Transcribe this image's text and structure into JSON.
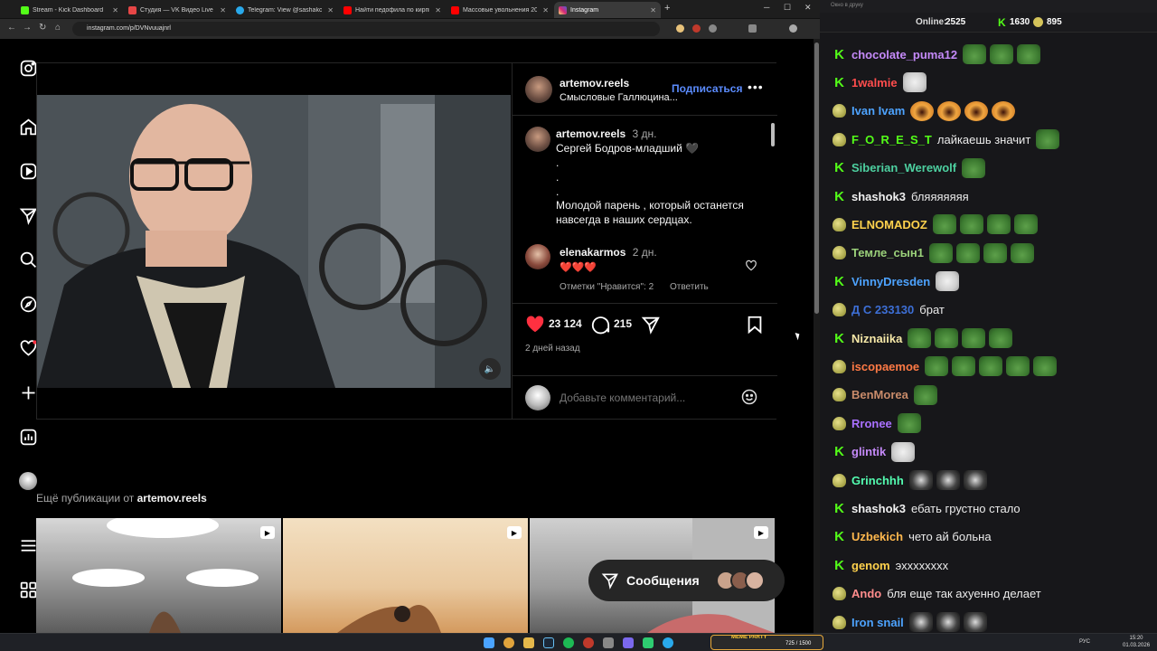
{
  "browser": {
    "tabs": [
      {
        "label": "Stream - Kick Dashboard",
        "color": "#53fc18"
      },
      {
        "label": "Студия — VK Видео Live",
        "color": "#e64646"
      },
      {
        "label": "Telegram: View @sashakon",
        "color": "#29a9eb"
      },
      {
        "label": "Найти педофила по кирпичу",
        "color": "#ff0000"
      },
      {
        "label": "Массовые увольнения 2026. I",
        "color": "#ff0000"
      },
      {
        "label": "Instagram",
        "color": "#d6249f"
      }
    ],
    "url": "instagram.com/p/DVNvuuajnrl"
  },
  "post": {
    "author": "artemov.reels",
    "subtitle": "Смысловые Галлюцина...",
    "follow_label": "Подписаться",
    "caption_author": "artemov.reels",
    "caption_time": "3 дн.",
    "caption_line1": "Сергей Бодров-младший 🖤",
    "caption_dot": ".",
    "caption_text": "Молодой парень , который останется навсегда в наших сердцах.",
    "comment_author": "elenakarmos",
    "comment_time": "2 дн.",
    "comment_text": "❤️❤️❤️",
    "comment_likes": "Отметки \"Нравится\": 2",
    "comment_reply": "Ответить",
    "likes": "23 124",
    "comments_count": "215",
    "posted": "2 дней назад",
    "add_comment_placeholder": "Добавьте комментарий..."
  },
  "more": {
    "prefix": "Ещё публикации от ",
    "author": "artemov.reels"
  },
  "messages_button": "Сообщения",
  "chat": {
    "title": "Окно в друку",
    "online_label": "Online: ",
    "online": "2525",
    "kick_count": "1630",
    "other_count": "895",
    "messages": [
      {
        "badge": "k",
        "name": "chocolate_puma12",
        "color": "#c58af9",
        "text": "",
        "emotes": [
          "frog",
          "frog",
          "frog"
        ]
      },
      {
        "badge": "k",
        "name": "1walmie",
        "color": "#ff4d4d",
        "text": "",
        "emotes": [
          "cat"
        ]
      },
      {
        "badge": "b",
        "name": "Ivan Ivam",
        "color": "#4da3ff",
        "text": "",
        "emotes": [
          "scream",
          "scream",
          "scream",
          "scream"
        ]
      },
      {
        "badge": "b",
        "name": "F_O_R_E_S_T",
        "color": "#53fc18",
        "text": "лайкаешь значит",
        "emotes": [
          "frog"
        ]
      },
      {
        "badge": "k",
        "name": "Siberian_Werewolf",
        "color": "#4dd0a0",
        "text": "",
        "emotes": [
          "frog"
        ]
      },
      {
        "badge": "k",
        "name": "shashok3",
        "color": "#f0f0f0",
        "text": "бляяяяяяя",
        "emotes": []
      },
      {
        "badge": "b",
        "name": "ELNOMADOZ",
        "color": "#ffd24d",
        "text": "",
        "emotes": [
          "frog",
          "frog",
          "frog",
          "frog"
        ]
      },
      {
        "badge": "b",
        "name": "Темле_сын1",
        "color": "#9bd17a",
        "text": "",
        "emotes": [
          "frog",
          "frog",
          "frog",
          "frog"
        ]
      },
      {
        "badge": "k",
        "name": "VinnyDresden",
        "color": "#4da3ff",
        "text": "",
        "emotes": [
          "cat"
        ]
      },
      {
        "badge": "b",
        "name": "Д С 233130",
        "color": "#3d6fd6",
        "text": "брат",
        "emotes": []
      },
      {
        "badge": "k",
        "name": "Niznaiika",
        "color": "#f7e9a8",
        "text": "",
        "emotes": [
          "frog",
          "frog",
          "frog",
          "frog"
        ]
      },
      {
        "badge": "b",
        "name": "iscopaemoe",
        "color": "#ff7a45",
        "text": "",
        "emotes": [
          "frog",
          "frog",
          "frog",
          "frog",
          "frog"
        ]
      },
      {
        "badge": "b",
        "name": "BenMorea",
        "color": "#c98b6a",
        "text": "",
        "emotes": [
          "frog"
        ]
      },
      {
        "badge": "b",
        "name": "Rronee",
        "color": "#a970ff",
        "text": "",
        "emotes": [
          "frog"
        ]
      },
      {
        "badge": "k",
        "name": "glintik",
        "color": "#c58af9",
        "text": "",
        "emotes": [
          "cat"
        ]
      },
      {
        "badge": "b",
        "name": "Grinchhh",
        "color": "#53fcb0",
        "text": "",
        "emotes": [
          "blk",
          "blk",
          "blk"
        ]
      },
      {
        "badge": "k",
        "name": "shashok3",
        "color": "#f0f0f0",
        "text": "ебать грустно стало",
        "emotes": []
      },
      {
        "badge": "k",
        "name": "Uzbekich",
        "color": "#ffb84d",
        "text": "чето ай больна",
        "emotes": []
      },
      {
        "badge": "k",
        "name": "genom",
        "color": "#ffd24d",
        "text": "эхххххххх",
        "emotes": []
      },
      {
        "badge": "b",
        "name": "Ando",
        "color": "#ff8c8c",
        "text": "бля еще так ахуенно делает",
        "emotes": []
      },
      {
        "badge": "b",
        "name": "Iron snail",
        "color": "#4da3ff",
        "text": "",
        "emotes": [
          "blk",
          "blk",
          "blk"
        ]
      }
    ]
  },
  "taskbar": {
    "lang": "РУС",
    "time": "15:20",
    "date": "01.03.2026",
    "meme_party": "MEME PARTY",
    "meme_count": "725 / 1500"
  }
}
